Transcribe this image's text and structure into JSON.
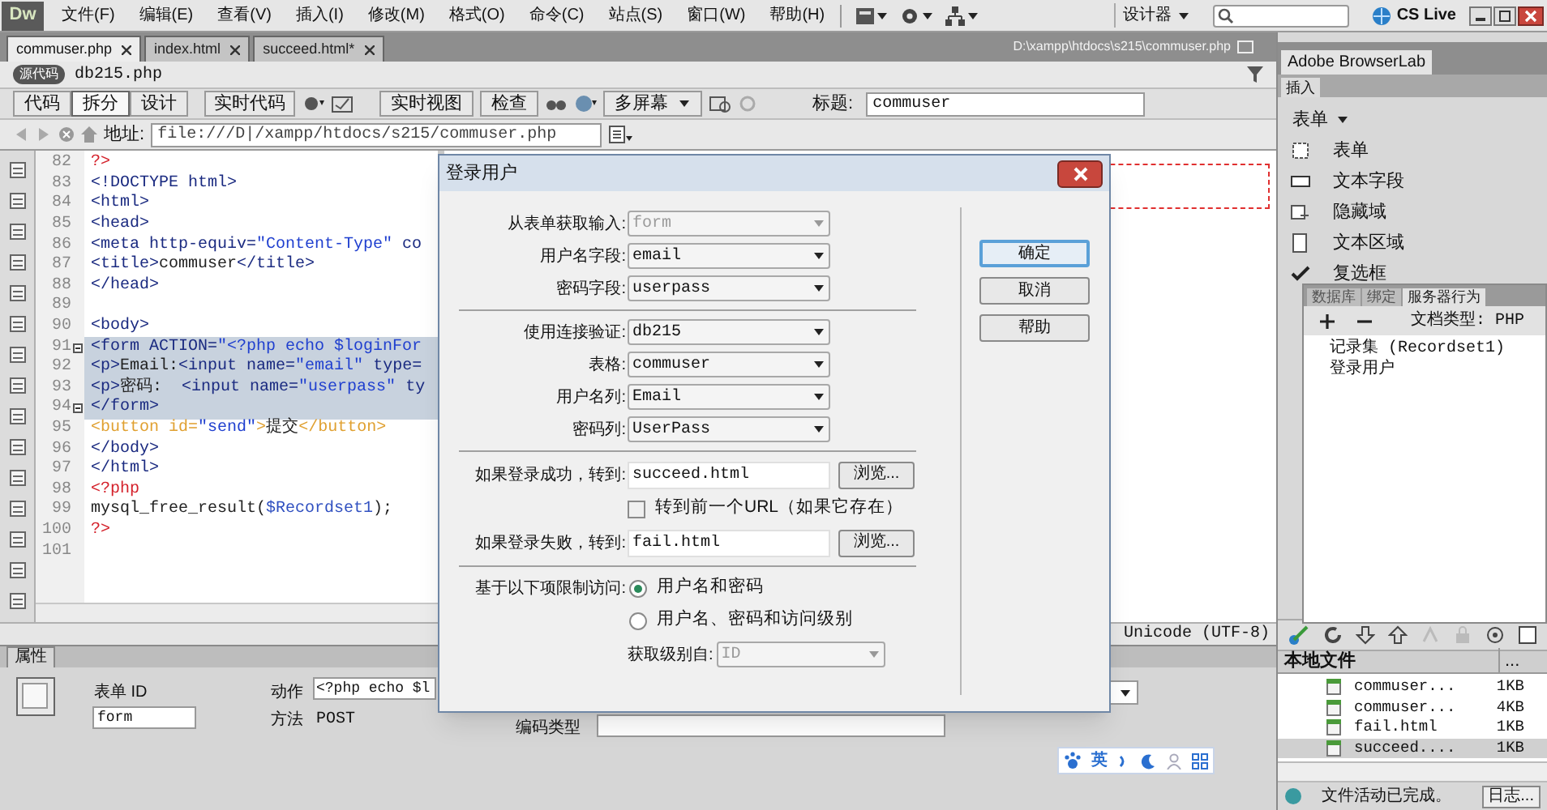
{
  "menubar": {
    "logo": "Dw",
    "menus": [
      "文件(F)",
      "编辑(E)",
      "查看(V)",
      "插入(I)",
      "修改(M)",
      "格式(O)",
      "命令(C)",
      "站点(S)",
      "窗口(W)",
      "帮助(H)"
    ],
    "workspace": "设计器",
    "cs_live": "CS Live"
  },
  "doc_tabs": [
    {
      "label": "commuser.php",
      "selected": true
    },
    {
      "label": "index.html",
      "selected": false
    },
    {
      "label": "succeed.html*",
      "selected": false
    }
  ],
  "doc_path": "D:\\xampp\\htdocs\\s215\\commuser.php",
  "related_files": {
    "source": "源代码",
    "files": [
      "db215.php"
    ]
  },
  "doc_toolbar": {
    "views": [
      {
        "label": "代码",
        "selected": false
      },
      {
        "label": "拆分",
        "selected": true
      },
      {
        "label": "设计",
        "selected": false
      }
    ],
    "live_code": "实时代码",
    "live_view": "实时视图",
    "inspect": "检查",
    "multiscreen": "多屏幕",
    "title_label": "标题:",
    "title_value": "commuser"
  },
  "address": {
    "label": "地址:",
    "value": "file:///D|/xampp/htdocs/s215/commuser.php"
  },
  "code": {
    "lines": [
      {
        "number": "82",
        "selected": false,
        "fold": false,
        "tokens": [
          {
            "kind": "php",
            "text": "?>"
          }
        ]
      },
      {
        "number": "83",
        "selected": false,
        "fold": false,
        "tokens": [
          {
            "kind": "tag",
            "text": "<!DOCTYPE html>"
          }
        ]
      },
      {
        "number": "84",
        "selected": false,
        "fold": false,
        "tokens": [
          {
            "kind": "tag",
            "text": "<html>"
          }
        ]
      },
      {
        "number": "85",
        "selected": false,
        "fold": false,
        "tokens": [
          {
            "kind": "tag",
            "text": "<head>"
          }
        ]
      },
      {
        "number": "86",
        "selected": false,
        "fold": false,
        "tokens": [
          {
            "kind": "tag",
            "text": "<meta http-equiv="
          },
          {
            "kind": "string",
            "text": "\"Content-Type\""
          },
          {
            "kind": "tag",
            "text": " co"
          }
        ]
      },
      {
        "number": "87",
        "selected": false,
        "fold": false,
        "tokens": [
          {
            "kind": "tag",
            "text": "<title>"
          },
          {
            "kind": "text",
            "text": "commuser"
          },
          {
            "kind": "tag",
            "text": "</title>"
          }
        ]
      },
      {
        "number": "88",
        "selected": false,
        "fold": false,
        "tokens": [
          {
            "kind": "tag",
            "text": "</head>"
          }
        ]
      },
      {
        "number": "89",
        "selected": false,
        "fold": false
      },
      {
        "number": "90",
        "selected": false,
        "fold": false,
        "tokens": [
          {
            "kind": "tag",
            "text": "<body>"
          }
        ]
      },
      {
        "number": "91",
        "selected": true,
        "fold": true,
        "tokens": [
          {
            "kind": "tag",
            "text": "<form ACTION="
          },
          {
            "kind": "string",
            "text": "\"<?php echo $loginFor"
          }
        ]
      },
      {
        "number": "92",
        "selected": true,
        "fold": false,
        "tokens": [
          {
            "kind": "tag",
            "text": "<p>"
          },
          {
            "kind": "text",
            "text": "Email:"
          },
          {
            "kind": "tag",
            "text": "<input name="
          },
          {
            "kind": "string",
            "text": "\"email\""
          },
          {
            "kind": "tag",
            "text": " type="
          }
        ]
      },
      {
        "number": "93",
        "selected": true,
        "fold": false,
        "tokens": [
          {
            "kind": "tag",
            "text": "<p>"
          },
          {
            "kind": "text",
            "text": "密码:  "
          },
          {
            "kind": "tag",
            "text": "<input name="
          },
          {
            "kind": "string",
            "text": "\"userpass\""
          },
          {
            "kind": "tag",
            "text": " ty"
          }
        ]
      },
      {
        "number": "94",
        "selected": true,
        "fold": true,
        "tokens": [
          {
            "kind": "tag",
            "text": "</form>"
          }
        ]
      },
      {
        "number": "95",
        "selected": false,
        "fold": false,
        "tokens": [
          {
            "kind": "button",
            "text": "<button "
          },
          {
            "kind": "button",
            "text": "id="
          },
          {
            "kind": "string",
            "text": "\"send\""
          },
          {
            "kind": "button",
            "text": ">"
          },
          {
            "kind": "text",
            "text": "提交"
          },
          {
            "kind": "button",
            "text": "</button>"
          }
        ]
      },
      {
        "number": "96",
        "selected": false,
        "fold": false,
        "tokens": [
          {
            "kind": "tag",
            "text": "</body>"
          }
        ]
      },
      {
        "number": "97",
        "selected": false,
        "fold": false,
        "tokens": [
          {
            "kind": "tag",
            "text": "</html>"
          }
        ]
      },
      {
        "number": "98",
        "selected": false,
        "fold": false,
        "tokens": [
          {
            "kind": "php",
            "text": "<?php"
          }
        ]
      },
      {
        "number": "99",
        "selected": false,
        "fold": false,
        "tokens": [
          {
            "kind": "text",
            "text": "mysql_free_result("
          },
          {
            "kind": "variable",
            "text": "$Recordset1"
          },
          {
            "kind": "text",
            "text": ");"
          }
        ]
      },
      {
        "number": "100",
        "selected": false,
        "fold": false,
        "tokens": [
          {
            "kind": "php",
            "text": "?>"
          }
        ]
      },
      {
        "number": "101",
        "selected": false,
        "fold": false
      }
    ]
  },
  "status_bar": {
    "encoding": "Unicode (UTF-8)"
  },
  "properties": {
    "tab": "属性",
    "form_id_label": "表单 ID",
    "form_id": "form",
    "action_label": "动作",
    "action": "<?php echo $l",
    "method_label": "方法",
    "method": "POST",
    "enctype_label": "编码类型"
  },
  "ime_bar": {
    "mode": "英"
  },
  "right_panel": {
    "browserlab": "Adobe BrowserLab",
    "insert_tab": "插入",
    "category": "表单",
    "insert_items": [
      "表单",
      "文本字段",
      "隐藏域",
      "文本区域",
      "复选框"
    ]
  },
  "server_panel": {
    "tabs": [
      {
        "label": "数据库",
        "selected": false
      },
      {
        "label": "绑定",
        "selected": false
      },
      {
        "label": "服务器行为",
        "selected": true
      }
    ],
    "doc_type": "文档类型: PHP",
    "behaviors": [
      "记录集 (Recordset1)",
      "登录用户"
    ]
  },
  "files_panel": {
    "columns": [
      "本地文件",
      "..."
    ],
    "rows": [
      {
        "name": "commuser...",
        "size": "1KB",
        "selected": false
      },
      {
        "name": "commuser...",
        "size": "4KB",
        "selected": false
      },
      {
        "name": "fail.html",
        "size": "1KB",
        "selected": false
      },
      {
        "name": "succeed....",
        "size": "1KB",
        "selected": true
      }
    ],
    "status": "文件活动已完成。",
    "log_button": "日志..."
  },
  "dialog": {
    "title": "登录用户",
    "groups": [
      [
        {
          "kind": "select",
          "label": "从表单获取输入:",
          "value": "form",
          "disabled": true
        },
        {
          "kind": "select",
          "label": "用户名字段:",
          "value": "email",
          "disabled": false
        },
        {
          "kind": "select",
          "label": "密码字段:",
          "value": "userpass",
          "disabled": false
        }
      ],
      [
        {
          "kind": "select",
          "label": "使用连接验证:",
          "value": "db215",
          "disabled": false
        },
        {
          "kind": "select",
          "label": "表格:",
          "value": "commuser",
          "disabled": false
        },
        {
          "kind": "select",
          "label": "用户名列:",
          "value": "Email",
          "disabled": false
        },
        {
          "kind": "select",
          "label": "密码列:",
          "value": "UserPass",
          "disabled": false
        }
      ],
      [
        {
          "kind": "text",
          "label": "如果登录成功，转到:",
          "value": "succeed.html",
          "button": "浏览..."
        },
        {
          "kind": "checkbox",
          "label": "转到前一个URL（如果它存在）",
          "checked": false
        },
        {
          "kind": "text",
          "label": "如果登录失败，转到:",
          "value": "fail.html",
          "button": "浏览..."
        }
      ],
      [
        {
          "kind": "radio",
          "label": "基于以下项限制访问:",
          "option": "用户名和密码",
          "selected": true
        },
        {
          "kind": "radio",
          "option": "用户名、密码和访问级别",
          "selected": false
        },
        {
          "kind": "inline-select",
          "label": "获取级别自:",
          "value": "ID",
          "disabled": true
        }
      ]
    ],
    "buttons": [
      {
        "label": "确定",
        "default": true
      },
      {
        "label": "取消",
        "default": false
      },
      {
        "label": "帮助",
        "default": false
      }
    ]
  }
}
